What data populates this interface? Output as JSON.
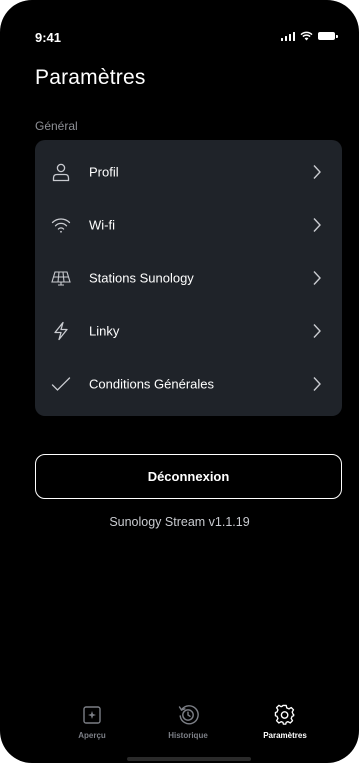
{
  "status_bar": {
    "time": "9:41"
  },
  "header": {
    "title": "Paramètres"
  },
  "section": {
    "label": "Général"
  },
  "settings": {
    "items": [
      {
        "label": "Profil",
        "icon": "user-icon"
      },
      {
        "label": "Wi-fi",
        "icon": "wifi-icon"
      },
      {
        "label": "Stations Sunology",
        "icon": "solar-panel-icon"
      },
      {
        "label": "Linky",
        "icon": "lightning-icon"
      },
      {
        "label": "Conditions Générales",
        "icon": "checkmark-icon"
      }
    ]
  },
  "logout": {
    "label": "Déconnexion"
  },
  "footer": {
    "version": "Sunology Stream v1.1.19"
  },
  "tab_bar": {
    "tabs": [
      {
        "label": "Aperçu",
        "icon": "overview-icon",
        "active": false
      },
      {
        "label": "Historique",
        "icon": "history-icon",
        "active": false
      },
      {
        "label": "Paramètres",
        "icon": "settings-gear-icon",
        "active": true
      }
    ]
  },
  "colors": {
    "background": "#000000",
    "card": "#1f2329",
    "text": "#ffffff",
    "muted": "#8e9096",
    "tab_inactive": "#7c7f86"
  }
}
